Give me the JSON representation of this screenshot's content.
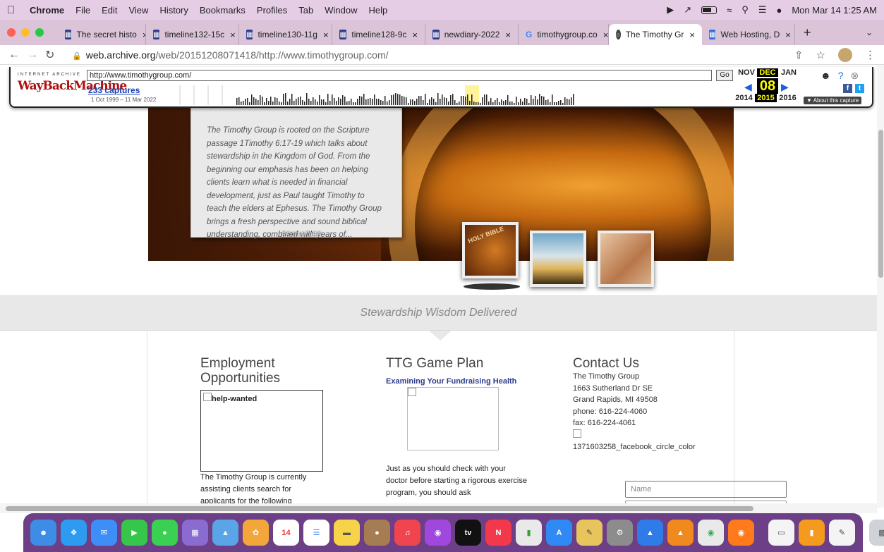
{
  "menubar": {
    "app": "Chrome",
    "items": [
      "File",
      "Edit",
      "View",
      "History",
      "Bookmarks",
      "Profiles",
      "Tab",
      "Window",
      "Help"
    ],
    "clock": "Mon Mar 14  1:25 AM"
  },
  "tabs": [
    {
      "title": "The secret histo",
      "icon": "grid-icon"
    },
    {
      "title": "timeline132-15c",
      "icon": "grid-icon"
    },
    {
      "title": "timeline130-11g",
      "icon": "grid-icon"
    },
    {
      "title": "timeline128-9c",
      "icon": "grid-icon"
    },
    {
      "title": "newdiary-2022",
      "icon": "grid-icon"
    },
    {
      "title": "timothygroup.co",
      "icon": "google-icon"
    },
    {
      "title": "The Timothy Gr",
      "icon": "globe-icon",
      "active": true
    },
    {
      "title": "Web Hosting, D",
      "icon": "grid-icon"
    }
  ],
  "address": {
    "domain": "web.archive.org",
    "path": "/web/20151208071418/http://www.timothygroup.com/"
  },
  "wayback": {
    "logo_top": "INTERNET ARCHIVE",
    "logo": "WayBackMachine",
    "url_value": "http://www.timothygroup.com/",
    "go": "Go",
    "captures": "233 captures",
    "range": "1 Oct 1999 – 11 Mar 2022",
    "months": [
      "NOV",
      "DEC",
      "JAN"
    ],
    "day": "08",
    "years": [
      "2014",
      "2015",
      "2016"
    ],
    "about": "▼ About this capture"
  },
  "hero": {
    "quote": "The Timothy Group is rooted on the Scripture passage 1Timothy 6:17-19 which talks about stewardship in the Kingdom of God. From the beginning our emphasis has been on helping clients learn what is needed in financial development, just as Paul taught Timothy to teach the elders at Ephesus. The Timothy Group brings a fresh perspective and sound biblical understanding, combined with years of...",
    "read_more": "READ MORE",
    "thumb_label": "HOLY BIBLE"
  },
  "tagline": "Stewardship Wisdom Delivered",
  "columns": {
    "employment": {
      "title": "Employment Opportunities",
      "img_alt": "help-wanted",
      "text": "The Timothy Group is currently assisting clients search for applicants for the  following"
    },
    "gameplan": {
      "title": "TTG Game Plan",
      "link": "Examining Your Fundraising Health",
      "text": "Just as you should check with your doctor before starting a rigorous exercise program, you should ask"
    },
    "contact": {
      "title": "Contact Us",
      "lines": [
        "The Timothy Group",
        "1663 Sutherland Dr SE",
        "Grand Rapids, MI 49508",
        "phone: 616-224-4060",
        "fax: 616-224-4061"
      ],
      "fb_alt": "1371603258_facebook_circle_color",
      "name_placeholder": "Name"
    }
  }
}
